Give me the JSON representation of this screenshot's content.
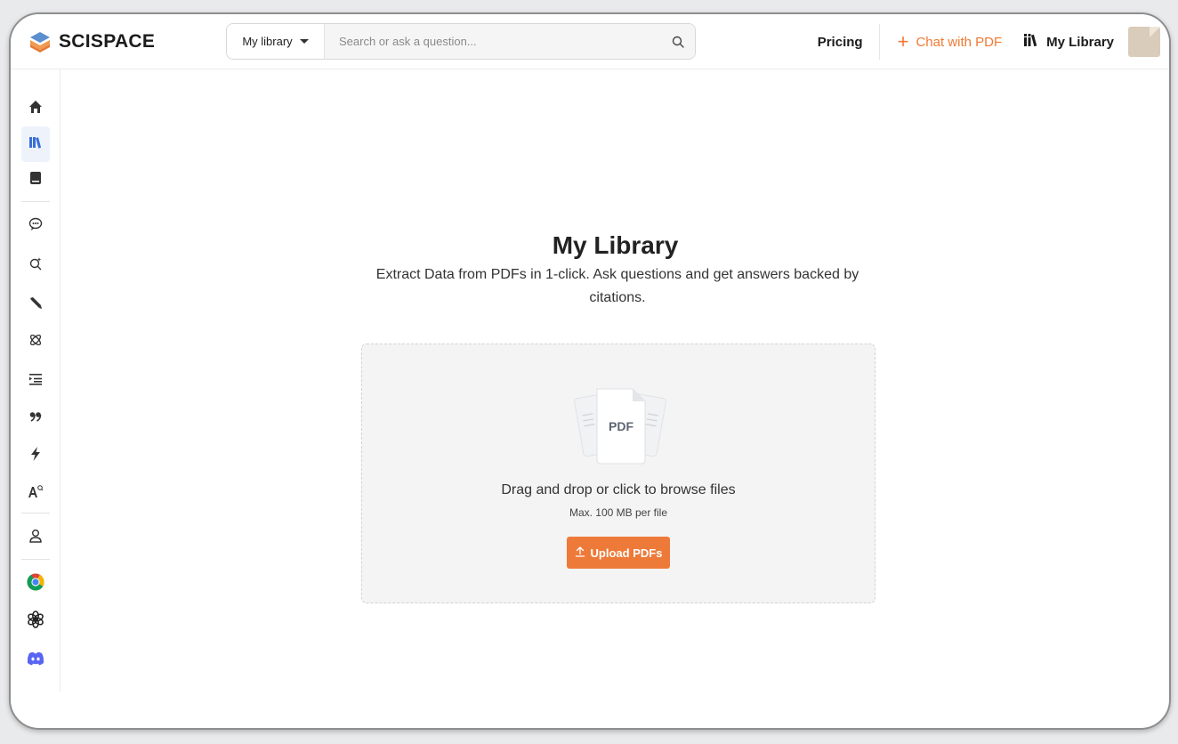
{
  "brand": {
    "name": "SCISPACE",
    "accent": "#f07a33"
  },
  "search": {
    "scope_label": "My library",
    "placeholder": "Search or ask a question..."
  },
  "nav": {
    "pricing": "Pricing",
    "chat_with_pdf": "Chat with PDF",
    "my_library": "My Library"
  },
  "sidebar": {
    "items": [
      {
        "icon": "home-icon"
      },
      {
        "icon": "library-icon",
        "active": true
      },
      {
        "icon": "notebook-icon"
      },
      {
        "icon": "chat-icon"
      },
      {
        "icon": "search-sparkle-icon"
      },
      {
        "icon": "pen-icon"
      },
      {
        "icon": "network-icon"
      },
      {
        "icon": "outline-icon"
      },
      {
        "icon": "quote-icon"
      },
      {
        "icon": "lightning-icon"
      },
      {
        "icon": "ai-detector-icon"
      },
      {
        "icon": "user-icon"
      },
      {
        "icon": "chrome-icon"
      },
      {
        "icon": "openai-icon"
      },
      {
        "icon": "discord-icon"
      }
    ]
  },
  "main": {
    "title": "My Library",
    "subtitle": "Extract Data from PDFs in 1-click. Ask questions and get answers backed by citations.",
    "dropzone": {
      "file_label": "PDF",
      "instruction": "Drag and drop or click to browse files",
      "limit": "Max. 100 MB per file",
      "upload_label": "Upload PDFs"
    }
  }
}
